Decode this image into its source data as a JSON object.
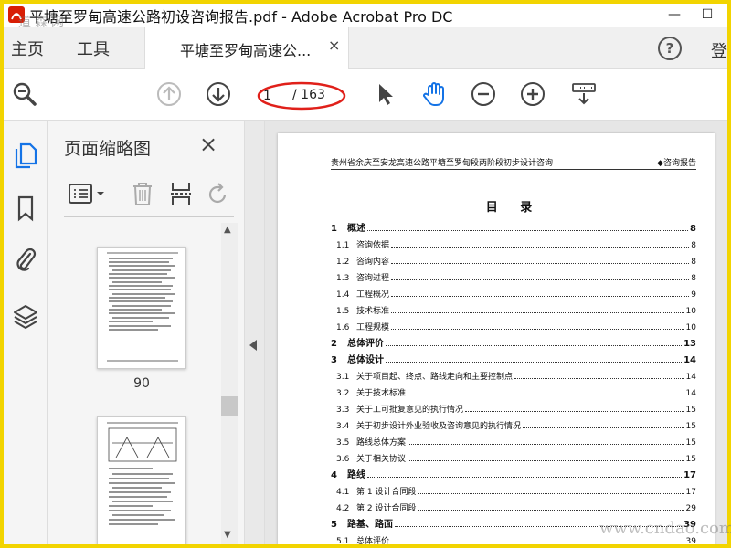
{
  "window": {
    "title": "平塘至罗甸高速公路初设咨询报告.pdf - Adobe Acrobat Pro DC",
    "watermark_top": "道森网",
    "minimize": "—",
    "maximize": "☐"
  },
  "tabs": {
    "home": "主页",
    "tools": "工具",
    "document": "平塘至罗甸高速公...",
    "close": "×",
    "help": "?",
    "signin": "登"
  },
  "toolbar": {
    "current_page": "1",
    "page_total": "/ 163"
  },
  "thumbnails": {
    "title": "页面缩略图",
    "close": "×",
    "pages": [
      {
        "number": "90"
      },
      {
        "number": ""
      }
    ]
  },
  "document": {
    "header_left": "贵州省余庆至安龙高速公路平塘至罗甸段两阶段初步设计咨询",
    "header_right": "◆咨询报告",
    "toc_title": "目 录",
    "toc": [
      {
        "num": "1",
        "text": "概述",
        "page": "8",
        "level": 1
      },
      {
        "num": "1.1",
        "text": "咨询依据",
        "page": "8",
        "level": 2
      },
      {
        "num": "1.2",
        "text": "咨询内容",
        "page": "8",
        "level": 2
      },
      {
        "num": "1.3",
        "text": "咨询过程",
        "page": "8",
        "level": 2
      },
      {
        "num": "1.4",
        "text": "工程概况",
        "page": "9",
        "level": 2
      },
      {
        "num": "1.5",
        "text": "技术标准",
        "page": "10",
        "level": 2
      },
      {
        "num": "1.6",
        "text": "工程规模",
        "page": "10",
        "level": 2
      },
      {
        "num": "2",
        "text": "总体评价",
        "page": "13",
        "level": 1
      },
      {
        "num": "3",
        "text": "总体设计",
        "page": "14",
        "level": 1
      },
      {
        "num": "3.1",
        "text": "关于项目起、终点、路线走向和主要控制点",
        "page": "14",
        "level": 2
      },
      {
        "num": "3.2",
        "text": "关于技术标准",
        "page": "14",
        "level": 2
      },
      {
        "num": "3.3",
        "text": "关于工可批复意见的执行情况",
        "page": "15",
        "level": 2
      },
      {
        "num": "3.4",
        "text": "关于初步设计外业验收及咨询意见的执行情况",
        "page": "15",
        "level": 2
      },
      {
        "num": "3.5",
        "text": "路线总体方案",
        "page": "15",
        "level": 2
      },
      {
        "num": "3.6",
        "text": "关于相关协议",
        "page": "15",
        "level": 2
      },
      {
        "num": "4",
        "text": "路线",
        "page": "17",
        "level": 1
      },
      {
        "num": "4.1",
        "text": "第 1 设计合同段",
        "page": "17",
        "level": 2
      },
      {
        "num": "4.2",
        "text": "第 2 设计合同段",
        "page": "29",
        "level": 2
      },
      {
        "num": "5",
        "text": "路基、路面",
        "page": "39",
        "level": 1
      },
      {
        "num": "5.1",
        "text": "总体评价",
        "page": "39",
        "level": 2
      }
    ]
  },
  "watermark_bottom": "www.cndao.com",
  "colors": {
    "accent_blue": "#1473e6",
    "border_yellow": "#f2d400",
    "annotation_red": "#e0201a"
  }
}
